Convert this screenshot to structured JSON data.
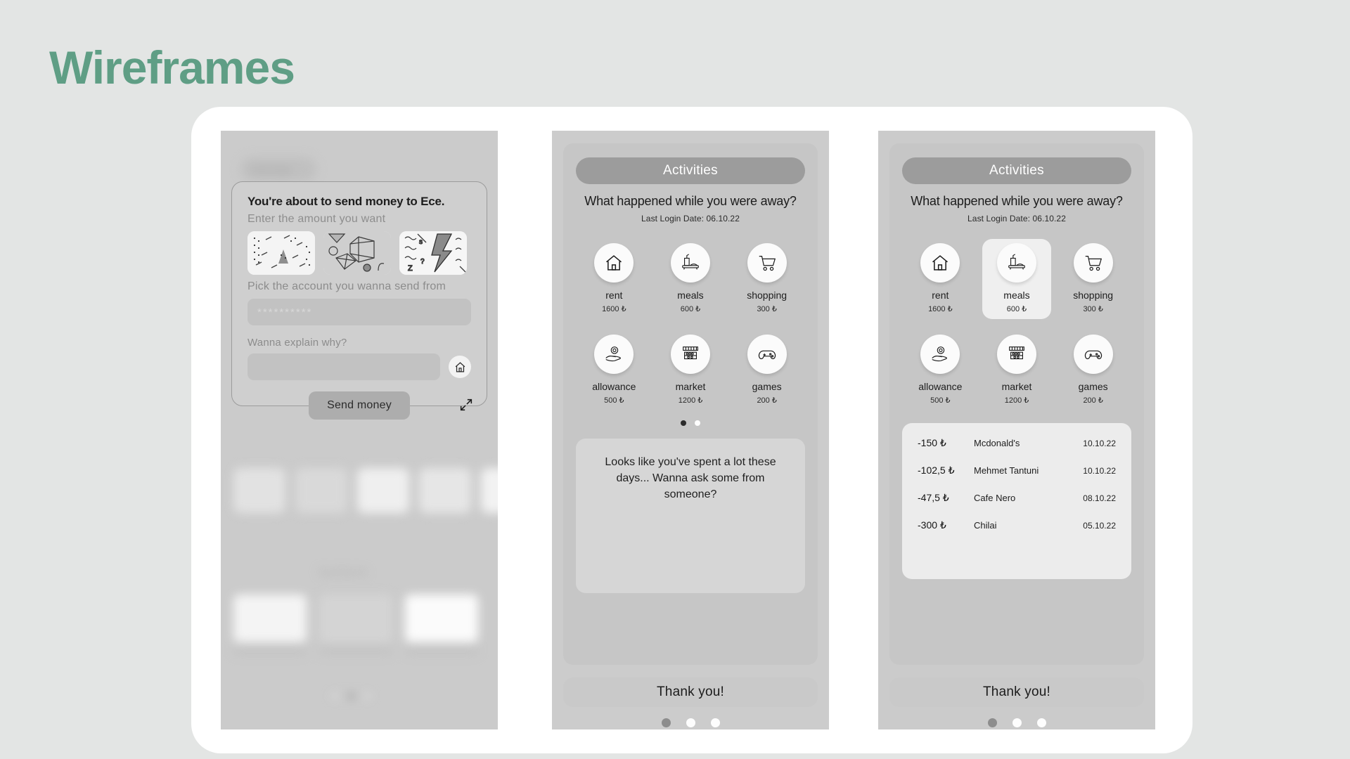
{
  "page": {
    "title": "Wireframes",
    "title_color": "#5f9e85",
    "background": "#e3e5e4"
  },
  "phone1": {
    "modal": {
      "headline": "You're about to send money to Ece.",
      "amount_label": "Enter the amount you want",
      "account_label": "Pick the account you wanna send from",
      "account_value": "**********",
      "explain_label": "Wanna explain why?",
      "explain_value": "",
      "mini_button_icon": "home-icon",
      "send_label": "Send money",
      "expand_icon": "expand-arrows-icon",
      "patterns": [
        "pattern-triangle-dashes",
        "pattern-cube-shapes",
        "pattern-lightning-squiggles"
      ]
    },
    "background": {
      "top_pill": "Savings",
      "section_title": "Kartlarim",
      "dots": [
        "inactive",
        "active",
        "inactive"
      ]
    }
  },
  "phone2": {
    "header": {
      "pill": "Activities",
      "question": "What happened while you were away?",
      "last_login": "Last Login Date: 06.10.22"
    },
    "categories": [
      {
        "name": "rent",
        "amount": "1600 ₺",
        "icon": "home-icon",
        "selected": false
      },
      {
        "name": "meals",
        "amount": "600 ₺",
        "icon": "meal-tray-icon",
        "selected": false
      },
      {
        "name": "shopping",
        "amount": "300 ₺",
        "icon": "cart-icon",
        "selected": false
      },
      {
        "name": "allowance",
        "amount": "500 ₺",
        "icon": "hand-coin-icon",
        "selected": false
      },
      {
        "name": "market",
        "amount": "1200 ₺",
        "icon": "market-stall-icon",
        "selected": false
      },
      {
        "name": "games",
        "amount": "200 ₺",
        "icon": "gamepad-icon",
        "selected": false
      }
    ],
    "carousel_dots": [
      "active",
      "inactive"
    ],
    "message": "Looks like you've spent a lot these days... Wanna ask some from someone?",
    "footer": {
      "label": "Thank you!",
      "dots": [
        "active",
        "inactive",
        "inactive"
      ]
    }
  },
  "phone3": {
    "header": {
      "pill": "Activities",
      "question": "What happened while you were away?",
      "last_login": "Last Login Date: 06.10.22"
    },
    "categories": [
      {
        "name": "rent",
        "amount": "1600 ₺",
        "icon": "home-icon",
        "selected": false
      },
      {
        "name": "meals",
        "amount": "600 ₺",
        "icon": "meal-tray-icon",
        "selected": true
      },
      {
        "name": "shopping",
        "amount": "300 ₺",
        "icon": "cart-icon",
        "selected": false
      },
      {
        "name": "allowance",
        "amount": "500 ₺",
        "icon": "hand-coin-icon",
        "selected": false
      },
      {
        "name": "market",
        "amount": "1200 ₺",
        "icon": "market-stall-icon",
        "selected": false
      },
      {
        "name": "games",
        "amount": "200 ₺",
        "icon": "gamepad-icon",
        "selected": false
      }
    ],
    "transactions": [
      {
        "amount": "-150 ₺",
        "merchant": "Mcdonald's",
        "date": "10.10.22"
      },
      {
        "amount": "-102,5 ₺",
        "merchant": "Mehmet Tantuni",
        "date": "10.10.22"
      },
      {
        "amount": "-47,5 ₺",
        "merchant": "Cafe Nero",
        "date": "08.10.22"
      },
      {
        "amount": "-300 ₺",
        "merchant": "Chilai",
        "date": "05.10.22"
      }
    ],
    "footer": {
      "label": "Thank you!",
      "dots": [
        "active",
        "inactive",
        "inactive"
      ]
    }
  }
}
